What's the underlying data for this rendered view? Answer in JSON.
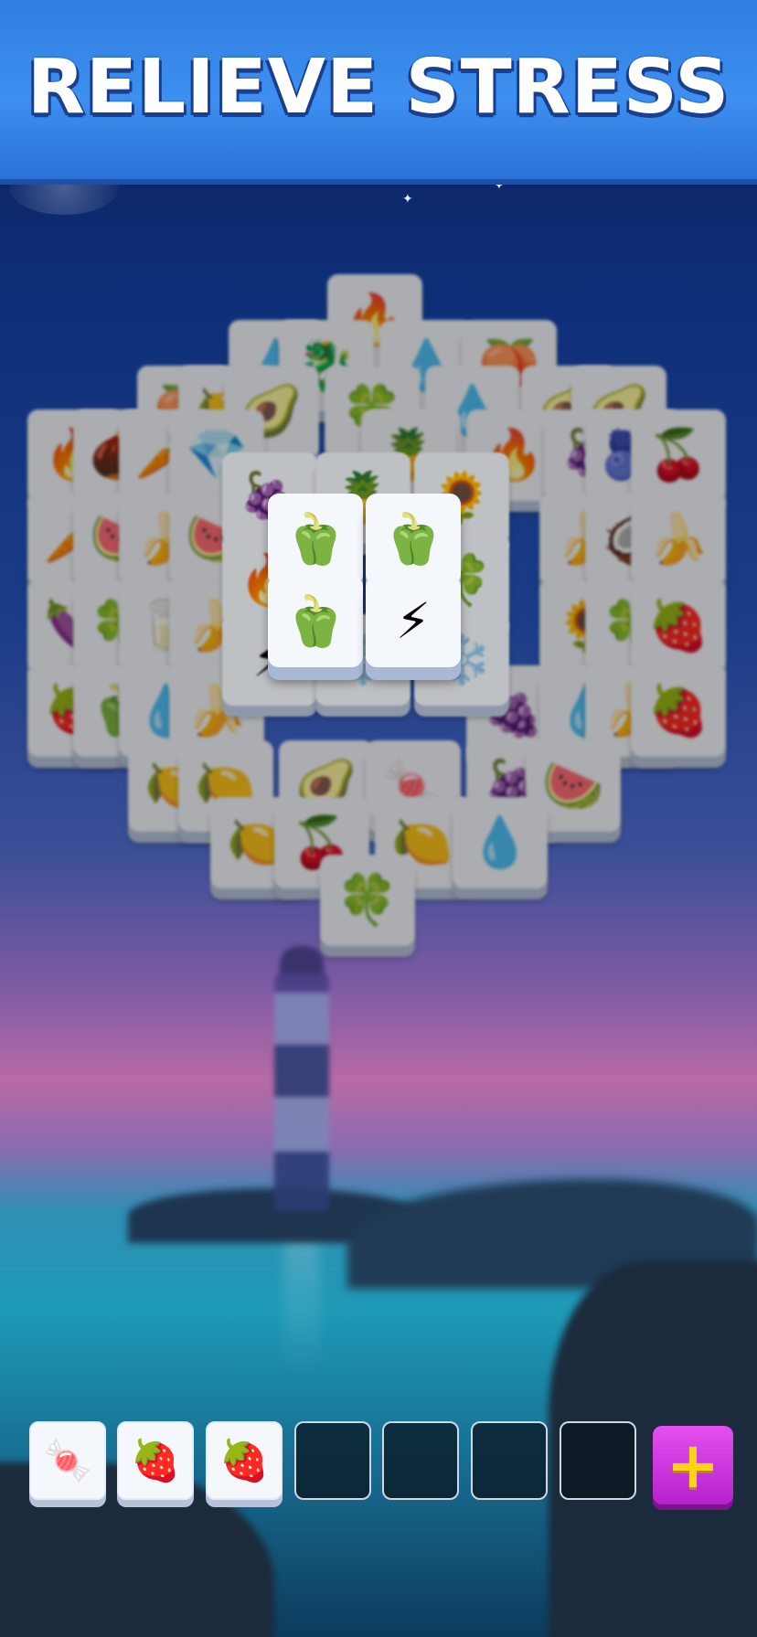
{
  "banner": {
    "title": "RELIEVE STRESS"
  },
  "icons": {
    "fire": "🔥",
    "drop": "💧",
    "dragonfruit": "🐉",
    "peach": "🍑",
    "avocado": "🥑",
    "clover": "🍀",
    "acorn": "🌰",
    "carrot": "🥕",
    "gem": "💎",
    "pineapple": "🍍",
    "grapes": "🍇",
    "blueberry": "🫐",
    "cherry": "🍒",
    "watermelon": "🍉",
    "banana": "🍌",
    "coconut": "🥥",
    "plum": "🍆",
    "milk": "🥛",
    "sunflower": "🌻",
    "strawberry": "🍓",
    "pepper": "🫑",
    "raspberry": "🍇",
    "bolt": "⚡",
    "snowflake": "❄️",
    "candy": "🍬",
    "lemon": "🍋"
  },
  "tiles": {
    "bottom": [
      "fire",
      "drop",
      "dragonfruit",
      "drop",
      "peach",
      "peach",
      "lemon",
      "avocado",
      "clover",
      "drop",
      "avocado",
      "avocado",
      "fire",
      "acorn",
      "carrot",
      "gem",
      "pineapple",
      "pineapple",
      "fire",
      "grapes",
      "blueberry",
      "cherry",
      "carrot",
      "watermelon",
      "banana",
      "watermelon",
      "banana",
      "coconut",
      "banana",
      "plum",
      "clover",
      "milk",
      "banana",
      "sunflower",
      "clover",
      "strawberry",
      "strawberry",
      "pepper",
      "drop",
      "banana",
      "grapes",
      "drop",
      "banana",
      "strawberry",
      "lemon",
      "lemon",
      "avocado",
      "candy",
      "raspberry",
      "watermelon",
      "lemon",
      "cherry",
      "lemon",
      "drop",
      "clover"
    ],
    "mid": [
      "raspberry",
      "pineapple",
      "sunflower",
      "fire",
      "clover",
      "bolt",
      "snowflake",
      "snowflake"
    ],
    "top": [
      "pepper",
      "pepper",
      "pepper",
      "bolt"
    ]
  },
  "tray": {
    "slots": [
      "candy",
      "strawberry",
      "strawberry",
      "",
      "",
      "",
      ""
    ],
    "plus_label": "+"
  }
}
